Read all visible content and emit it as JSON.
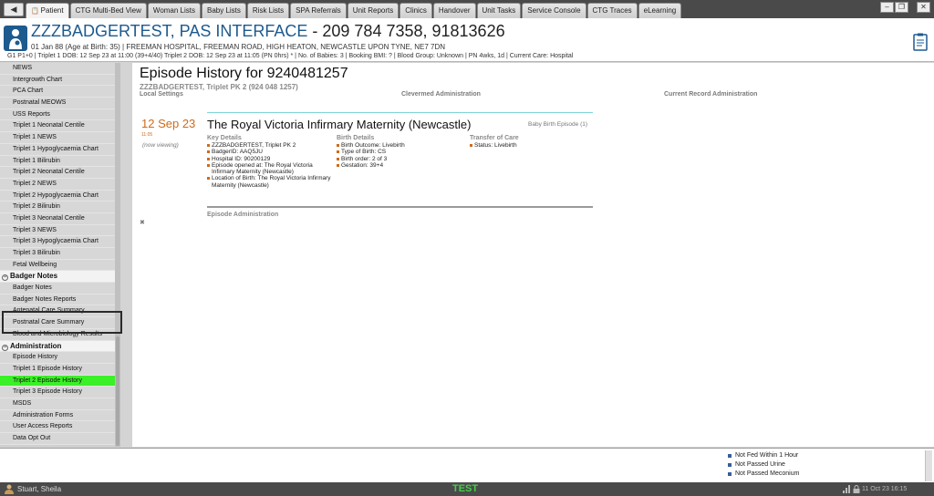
{
  "tabs": [
    {
      "label": "Patient",
      "active": true
    },
    {
      "label": "CTG Multi-Bed View",
      "active": false
    },
    {
      "label": "Woman Lists",
      "active": false
    },
    {
      "label": "Baby Lists",
      "active": false
    },
    {
      "label": "Risk Lists",
      "active": false
    },
    {
      "label": "SPA Referrals",
      "active": false
    },
    {
      "label": "Unit Reports",
      "active": false
    },
    {
      "label": "Clinics",
      "active": false
    },
    {
      "label": "Handover",
      "active": false
    },
    {
      "label": "Unit Tasks",
      "active": false
    },
    {
      "label": "Service Console",
      "active": false
    },
    {
      "label": "CTG Traces",
      "active": false
    },
    {
      "label": "eLearning",
      "active": false
    }
  ],
  "banner": {
    "name": "ZZZBADGERTEST, PAS INTERFACE",
    "ids": " - 209 784 7358, 91813626",
    "dob_line": "01 Jan 88 (Age at Birth: 35) | FREEMAN HOSPITAL, FREEMAN ROAD, HIGH HEATON, NEWCASTLE UPON TYNE, NE7 7DN",
    "info_line": "G1 P1+0 | Triplet 1 DOB: 12 Sep 23 at 11:00 (39+4/40) Triplet 2 DOB: 12 Sep 23 at 11:05 (PN 0hrs) * | No. of Babies: 3 | Booking BMI: ? | Blood Group: Unknown | PN 4wks, 1d | Current Care: Hospital"
  },
  "sidebar": {
    "items_top": [
      "NEWS",
      "Intergrowth Chart",
      "PCA Chart",
      "Postnatal MEOWS",
      "USS Reports",
      "Triplet 1 Neonatal Centile",
      "Triplet 1 NEWS",
      "Triplet 1 Hypoglycaemia Chart",
      "Triplet 1 Bilirubin",
      "Triplet 2 Neonatal Centile",
      "Triplet 2 NEWS",
      "Triplet 2 Hypoglycaemia Chart",
      "Triplet 2 Bilirubin",
      "Triplet 3 Neonatal Centile",
      "Triplet 3 NEWS",
      "Triplet 3 Hypoglycaemia Chart",
      "Triplet 3 Bilirubin",
      "Fetal Wellbeing"
    ],
    "section_badger": "Badger Notes",
    "items_badger": [
      "Badger Notes",
      "Badger Notes Reports",
      "Antenatal Care Summary",
      "Postnatal Care Summary",
      "Blood and Microbiology Results"
    ],
    "section_admin": "Administration",
    "items_admin": [
      "Episode History",
      "Triplet 1 Episode History",
      "Triplet 2 Episode History",
      "Triplet 3 Episode History",
      "MSDS",
      "Administration Forms",
      "User Access Reports",
      "Data Opt Out"
    ]
  },
  "main": {
    "title": "Episode History for 9240481257",
    "subtitle": "ZZZBADGERTEST, Triplet PK 2 (924 048 1257)",
    "links": [
      "Local Settings",
      "Clevermed Administration",
      "Current Record Administration"
    ],
    "episode": {
      "date": "12 Sep 23",
      "time": "11:05",
      "viewing": "(now viewing)",
      "hospital": "The Royal Victoria Infirmary Maternity (Newcastle)",
      "type": "Baby Birth Episode (1)",
      "key_details_head": "Key Details",
      "key_details": [
        "ZZZBADGERTEST, Triplet PK 2",
        "BadgerID: AAQ5JU",
        "Hospital ID: 90200129",
        "Episode opened at: The Royal Victoria Infirmary Maternity (Newcastle)",
        "Location of Birth: The Royal Victoria Infirmary Maternity (Newcastle)"
      ],
      "birth_details_head": "Birth Details",
      "birth_details": [
        "Birth Outcome: Livebirth",
        "Type of Birth: CS",
        "Birth order: 2 of 3",
        "Gestation: 39+4"
      ],
      "transfer_head": "Transfer of Care",
      "transfer": [
        "Status: Livebirth"
      ],
      "admin_label": "Episode Administration"
    }
  },
  "alerts": [
    "Not Fed Within 1 Hour",
    "Not Passed Urine",
    "Not Passed Meconium"
  ],
  "status": {
    "user": "Stuart, Sheila",
    "env": "TEST",
    "datetime": "11 Oct 23 16:15"
  },
  "colors": {
    "accent_blue": "#1d5a8e",
    "date_orange": "#d06a1a",
    "selected_green": "#3cf028",
    "env_green": "#44d04a"
  }
}
